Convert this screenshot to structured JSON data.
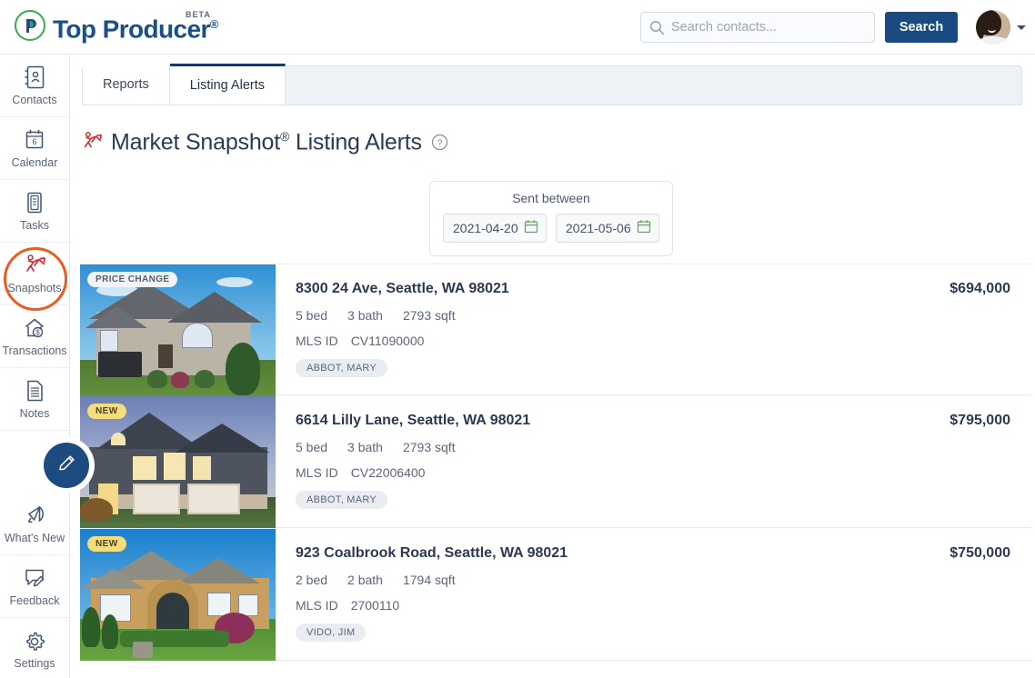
{
  "header": {
    "brand_name": "Top Producer",
    "brand_reg": "®",
    "beta_label": "BETA",
    "search_placeholder": "Search contacts...",
    "search_value": "",
    "search_button": "Search",
    "search_icon": "search-icon",
    "avatar_caret_icon": "chevron-down-icon"
  },
  "sidebar": {
    "items": [
      {
        "label": "Contacts",
        "icon": "contacts-icon"
      },
      {
        "label": "Calendar",
        "icon": "calendar-icon",
        "badge_number": "6"
      },
      {
        "label": "Tasks",
        "icon": "tasks-clipboard-icon"
      },
      {
        "label": "Snapshots",
        "icon": "market-snapshot-icon"
      },
      {
        "label": "Transactions",
        "icon": "house-dollar-icon"
      },
      {
        "label": "Notes",
        "icon": "notes-document-icon"
      },
      {
        "label": "What's New",
        "icon": "megaphone-icon"
      },
      {
        "label": "Feedback",
        "icon": "comment-pencil-icon"
      },
      {
        "label": "Settings",
        "icon": "gear-icon"
      }
    ],
    "active_item": "Snapshots",
    "fab_icon": "pencil-icon",
    "highlight_color": "#ed5b1f"
  },
  "main": {
    "tabs": [
      {
        "label": "Reports",
        "active": false
      },
      {
        "label": "Listing Alerts",
        "active": true
      }
    ],
    "page_title": "Market Snapshot",
    "page_title_sup": "®",
    "page_title_rest": " Listing Alerts",
    "page_title_icon": "market-snapshot-icon",
    "help_icon": "help-question-icon"
  },
  "filter": {
    "label": "Sent between",
    "start_date": "2021-04-20",
    "end_date": "2021-05-06",
    "calendar_icon": "calendar-icon",
    "calendar_icon_color": "#6aa765"
  },
  "listings": [
    {
      "badge": "PRICE CHANGE",
      "badge_type": "price-change",
      "address": "8300 24 Ave, Seattle, WA 98021",
      "beds": "5 bed",
      "baths": "3 bath",
      "sqft": "2793 sqft",
      "mls_label": "MLS ID",
      "mls_id": "CV11090000",
      "agent": "ABBOT, MARY",
      "price": "$694,000",
      "photo": "house-exterior-daytime"
    },
    {
      "badge": "NEW",
      "badge_type": "new",
      "address": "6614 Lilly Lane, Seattle, WA 98021",
      "beds": "5 bed",
      "baths": "3 bath",
      "sqft": "2793 sqft",
      "mls_label": "MLS ID",
      "mls_id": "CV22006400",
      "agent": "ABBOT, MARY",
      "price": "$795,000",
      "photo": "house-exterior-dusk"
    },
    {
      "badge": "NEW",
      "badge_type": "new",
      "address": "923 Coalbrook Road, Seattle, WA 98021",
      "beds": "2 bed",
      "baths": "2 bath",
      "sqft": "1794 sqft",
      "mls_label": "MLS ID",
      "mls_id": "2700110",
      "agent": "VIDO, JIM",
      "price": "$750,000",
      "photo": "house-exterior-tan-stucco"
    }
  ],
  "colors": {
    "brand_blue": "#1b4f8a",
    "brand_green": "#3aaa4a",
    "button_blue": "#1a4a82",
    "accent_orange": "#ed5b1f",
    "badge_new_yellow": "#f5dd7c",
    "text_dark": "#2b3a50"
  }
}
